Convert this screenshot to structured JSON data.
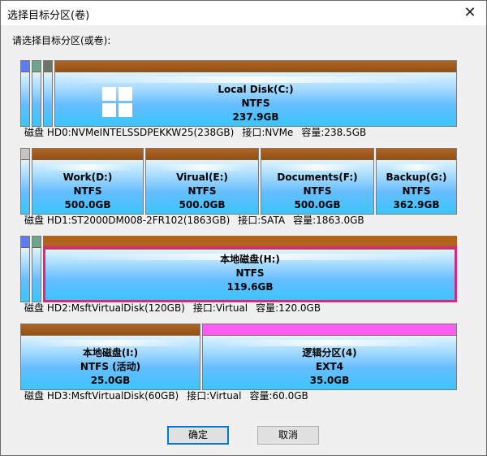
{
  "window": {
    "title": "选择目标分区(卷)",
    "close_glyph": "✕"
  },
  "prompt": "请选择目标分区(或卷):",
  "disks": [
    {
      "partitions": [
        {
          "name": "Local Disk(C:)",
          "fs": "NTFS",
          "size": "237.9GB"
        }
      ],
      "info": {
        "disk": "磁盘 HD0:NVMeINTELSSDPEKKW25(238GB)",
        "iface": "接口:NVMe",
        "capacity": "容量:238.5GB"
      }
    },
    {
      "partitions": [
        {
          "name": "Work(D:)",
          "fs": "NTFS",
          "size": "500.0GB"
        },
        {
          "name": "Virual(E:)",
          "fs": "NTFS",
          "size": "500.0GB"
        },
        {
          "name": "Documents(F:)",
          "fs": "NTFS",
          "size": "500.0GB"
        },
        {
          "name": "Backup(G:)",
          "fs": "NTFS",
          "size": "362.9GB"
        }
      ],
      "info": {
        "disk": "磁盘 HD1:ST2000DM008-2FR102(1863GB)",
        "iface": "接口:SATA",
        "capacity": "容量:1863.0GB"
      }
    },
    {
      "partitions": [
        {
          "name": "本地磁盘(H:)",
          "fs": "NTFS",
          "size": "119.6GB",
          "selected": true
        }
      ],
      "info": {
        "disk": "磁盘 HD2:MsftVirtualDisk(120GB)",
        "iface": "接口:Virtual",
        "capacity": "容量:120.0GB"
      }
    },
    {
      "partitions": [
        {
          "name": "本地磁盘(I:)",
          "fs": "NTFS (活动)",
          "size": "25.0GB"
        },
        {
          "name": "逻辑分区(4)",
          "fs": "EXT4",
          "size": "35.0GB"
        }
      ],
      "info": {
        "disk": "磁盘 HD3:MsftVirtualDisk(60GB)",
        "iface": "接口:Virtual",
        "capacity": "容量:60.0GB"
      }
    }
  ],
  "buttons": {
    "ok": "确定",
    "cancel": "取消"
  },
  "colors": {
    "selected_border": "#e0267a",
    "ext4_band": "#ff5cf4",
    "primary_band": "#b2641e"
  }
}
